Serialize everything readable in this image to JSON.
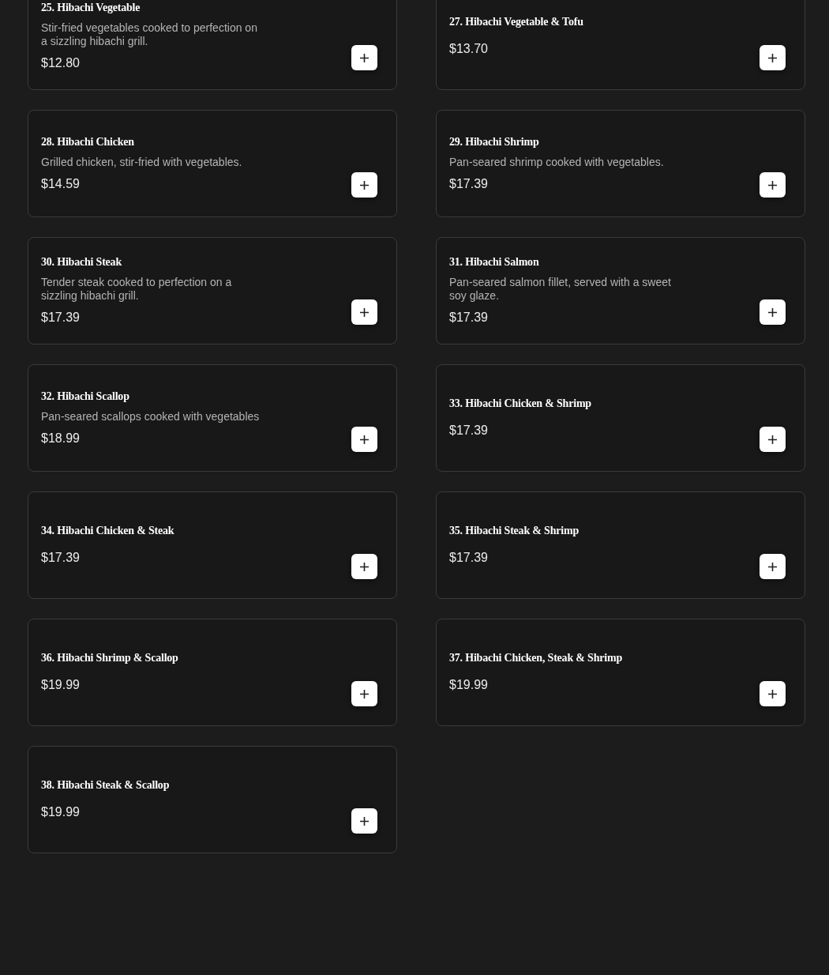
{
  "menu_items": [
    {
      "title": "25. Hibachi Vegetable",
      "description": "Stir-fried vegetables cooked to perfection on a sizzling hibachi grill.",
      "price": "$12.80"
    },
    {
      "title": "27. Hibachi Vegetable & Tofu",
      "price": "$13.70"
    },
    {
      "title": "28. Hibachi Chicken",
      "description": "Grilled chicken, stir-fried with vegetables.",
      "price": "$14.59"
    },
    {
      "title": "29. Hibachi Shrimp",
      "description": "Pan-seared shrimp cooked with vegetables.",
      "price": "$17.39"
    },
    {
      "title": "30. Hibachi Steak",
      "description": "Tender steak cooked to perfection on a sizzling hibachi grill.",
      "price": "$17.39"
    },
    {
      "title": "31. Hibachi Salmon",
      "description": "Pan-seared salmon fillet, served with a sweet soy glaze.",
      "price": "$17.39"
    },
    {
      "title": "32. Hibachi Scallop",
      "description": "Pan-seared scallops cooked with vegetables",
      "price": "$18.99"
    },
    {
      "title": "33. Hibachi Chicken & Shrimp",
      "price": "$17.39"
    },
    {
      "title": "34. Hibachi Chicken & Steak",
      "price": "$17.39"
    },
    {
      "title": "35. Hibachi Steak & Shrimp",
      "price": "$17.39"
    },
    {
      "title": "36. Hibachi Shrimp & Scallop",
      "price": "$19.99"
    },
    {
      "title": "37. Hibachi Chicken, Steak & Shrimp",
      "price": "$19.99"
    },
    {
      "title": "38. Hibachi Steak & Scallop",
      "price": "$19.99"
    }
  ]
}
